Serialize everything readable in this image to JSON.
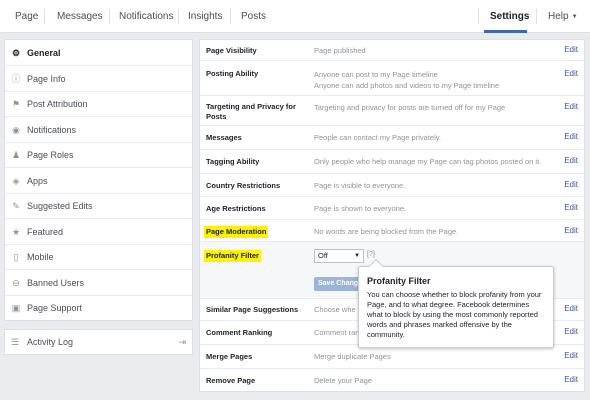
{
  "topnav": {
    "page": "Page",
    "messages": "Messages",
    "notifications": "Notifications",
    "insights": "Insights",
    "posts": "Posts",
    "settings": "Settings",
    "help": "Help"
  },
  "sidebar": {
    "items": [
      {
        "label": "General",
        "icon": "gear-icon",
        "glyph": "⚙"
      },
      {
        "label": "Page Info",
        "icon": "info-icon",
        "glyph": "ⓘ"
      },
      {
        "label": "Post Attribution",
        "icon": "flag-icon",
        "glyph": "⚑"
      },
      {
        "label": "Notifications",
        "icon": "globe-icon",
        "glyph": "◉"
      },
      {
        "label": "Page Roles",
        "icon": "person-icon",
        "glyph": "♟"
      },
      {
        "label": "Apps",
        "icon": "apps-icon",
        "glyph": "◈"
      },
      {
        "label": "Suggested Edits",
        "icon": "edit-icon",
        "glyph": "✎"
      },
      {
        "label": "Featured",
        "icon": "star-icon",
        "glyph": "★"
      },
      {
        "label": "Mobile",
        "icon": "mobile-icon",
        "glyph": "▯"
      },
      {
        "label": "Banned Users",
        "icon": "ban-icon",
        "glyph": "⊖"
      },
      {
        "label": "Page Support",
        "icon": "support-icon",
        "glyph": "▣"
      }
    ],
    "activity_log": {
      "label": "Activity Log",
      "icon": "list-icon",
      "glyph": "☰",
      "exit_glyph": "⇥"
    }
  },
  "settings_rows": [
    {
      "label": "Page Visibility",
      "value": "Page published",
      "edit": "Edit"
    },
    {
      "label": "Posting Ability",
      "value": "Anyone can post to my Page timeline",
      "value2": "Anyone can add photos and videos to my Page timeline",
      "edit": "Edit"
    },
    {
      "label": "Targeting and Privacy for Posts",
      "value": "Targeting and privacy for posts are turned off for my Page",
      "edit": "Edit"
    },
    {
      "label": "Messages",
      "value": "People can contact my Page privately.",
      "edit": "Edit"
    },
    {
      "label": "Tagging Ability",
      "value": "Only people who help manage my Page can tag photos posted on it.",
      "edit": "Edit"
    },
    {
      "label": "Country Restrictions",
      "value": "Page is visible to everyone.",
      "edit": "Edit"
    },
    {
      "label": "Age Restrictions",
      "value": "Page is shown to everyone.",
      "edit": "Edit"
    },
    {
      "label": "Page Moderation",
      "value": "No words are being blocked from the Page.",
      "edit": "Edit"
    },
    {
      "label": "Profanity Filter"
    },
    {
      "label": "Similar Page Suggestions",
      "value": "Choose whe",
      "edit": "Edit"
    },
    {
      "label": "Comment Ranking",
      "value": "Comment ran",
      "edit": "Edit"
    },
    {
      "label": "Merge Pages",
      "value": "Merge duplicate Pages",
      "edit": "Edit"
    },
    {
      "label": "Remove Page",
      "value": "Delete your Page",
      "edit": "Edit"
    }
  ],
  "profanity_filter": {
    "selected": "Off",
    "help": "[?]",
    "save_label": "Save Changes"
  },
  "tooltip": {
    "title": "Profanity Filter",
    "body": "You can choose whether to block profanity from your Page, and to what degree. Facebook determines what to block by using the most commonly reported words and phrases marked offensive by the community."
  },
  "colors": {
    "highlight": "#fff200",
    "link": "#365899",
    "accent": "#4267b2"
  }
}
